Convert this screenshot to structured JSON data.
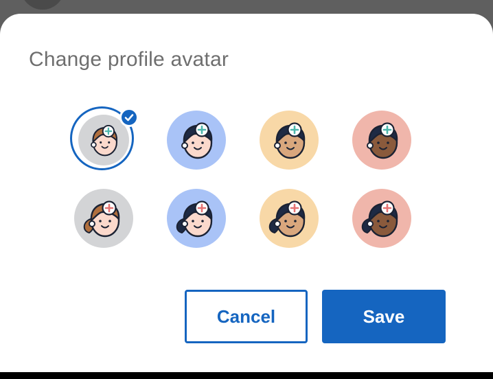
{
  "dialog": {
    "title": "Change profile avatar",
    "cancel_label": "Cancel",
    "save_label": "Save"
  },
  "avatars": [
    {
      "id": "avatar-1",
      "bg": "#d3d4d6",
      "skin": "#fbd9cc",
      "hair": "#b06f3e",
      "cross": "#4db6ac",
      "style": "short",
      "selected": true
    },
    {
      "id": "avatar-2",
      "bg": "#a9c3f7",
      "skin": "#fbd9cc",
      "hair": "#1e2a44",
      "cross": "#4db6ac",
      "style": "short",
      "selected": false
    },
    {
      "id": "avatar-3",
      "bg": "#f8d8a7",
      "skin": "#d9a77d",
      "hair": "#1e2a44",
      "cross": "#4db6ac",
      "style": "short",
      "selected": false
    },
    {
      "id": "avatar-4",
      "bg": "#f0b6ab",
      "skin": "#8a5a3c",
      "hair": "#1e2a44",
      "cross": "#4db6ac",
      "style": "short",
      "selected": false
    },
    {
      "id": "avatar-5",
      "bg": "#d3d4d6",
      "skin": "#fbd9cc",
      "hair": "#b06f3e",
      "cross": "#e57373",
      "style": "ponytail",
      "selected": false
    },
    {
      "id": "avatar-6",
      "bg": "#a9c3f7",
      "skin": "#fbd9cc",
      "hair": "#1e2a44",
      "cross": "#e57373",
      "style": "ponytail",
      "selected": false
    },
    {
      "id": "avatar-7",
      "bg": "#f8d8a7",
      "skin": "#d9a77d",
      "hair": "#1e2a44",
      "cross": "#e57373",
      "style": "ponytail",
      "selected": false
    },
    {
      "id": "avatar-8",
      "bg": "#f0b6ab",
      "skin": "#8a5a3c",
      "hair": "#1e2a44",
      "cross": "#e57373",
      "style": "ponytail",
      "selected": false
    }
  ],
  "colors": {
    "accent": "#1565c0",
    "title_text": "#6e6e6e",
    "backdrop": "#5f5f5f"
  },
  "icons": {
    "selected_check": "check-circle-icon"
  }
}
